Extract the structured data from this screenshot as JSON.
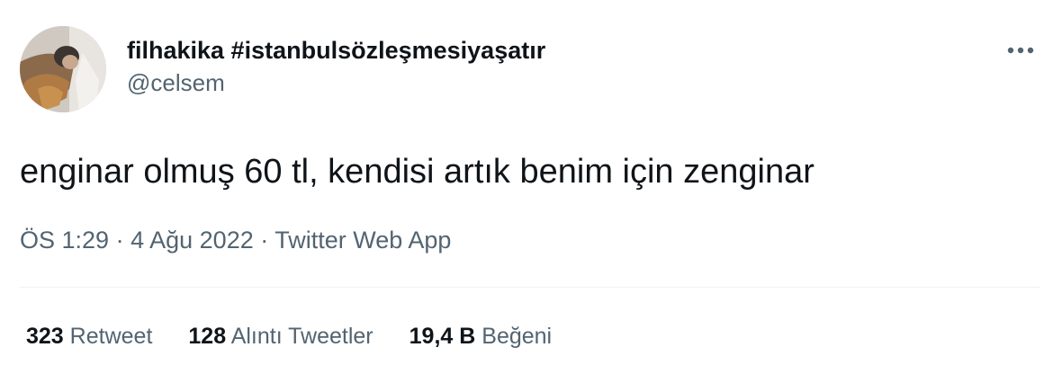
{
  "author": {
    "display_name": "filhakika #istanbulsözleşmesiyaşatır",
    "handle": "@celsem",
    "avatar_icon": "profile-photo"
  },
  "tweet": {
    "text": "enginar olmuş 60 tl, kendisi artık benim için zenginar",
    "time": "ÖS 1:29",
    "separator": "·",
    "date": "4 Ağu 2022",
    "source": "Twitter Web App"
  },
  "stats": {
    "retweets": {
      "count": "323",
      "label": "Retweet"
    },
    "quotes": {
      "count": "128",
      "label": "Alıntı Tweetler"
    },
    "likes": {
      "count": "19,4 B",
      "label": "Beğeni"
    }
  },
  "icons": {
    "more": "more-horizontal-icon"
  },
  "colors": {
    "primary_text": "#0f1419",
    "secondary_text": "#536471",
    "divider": "#eff3f4"
  }
}
